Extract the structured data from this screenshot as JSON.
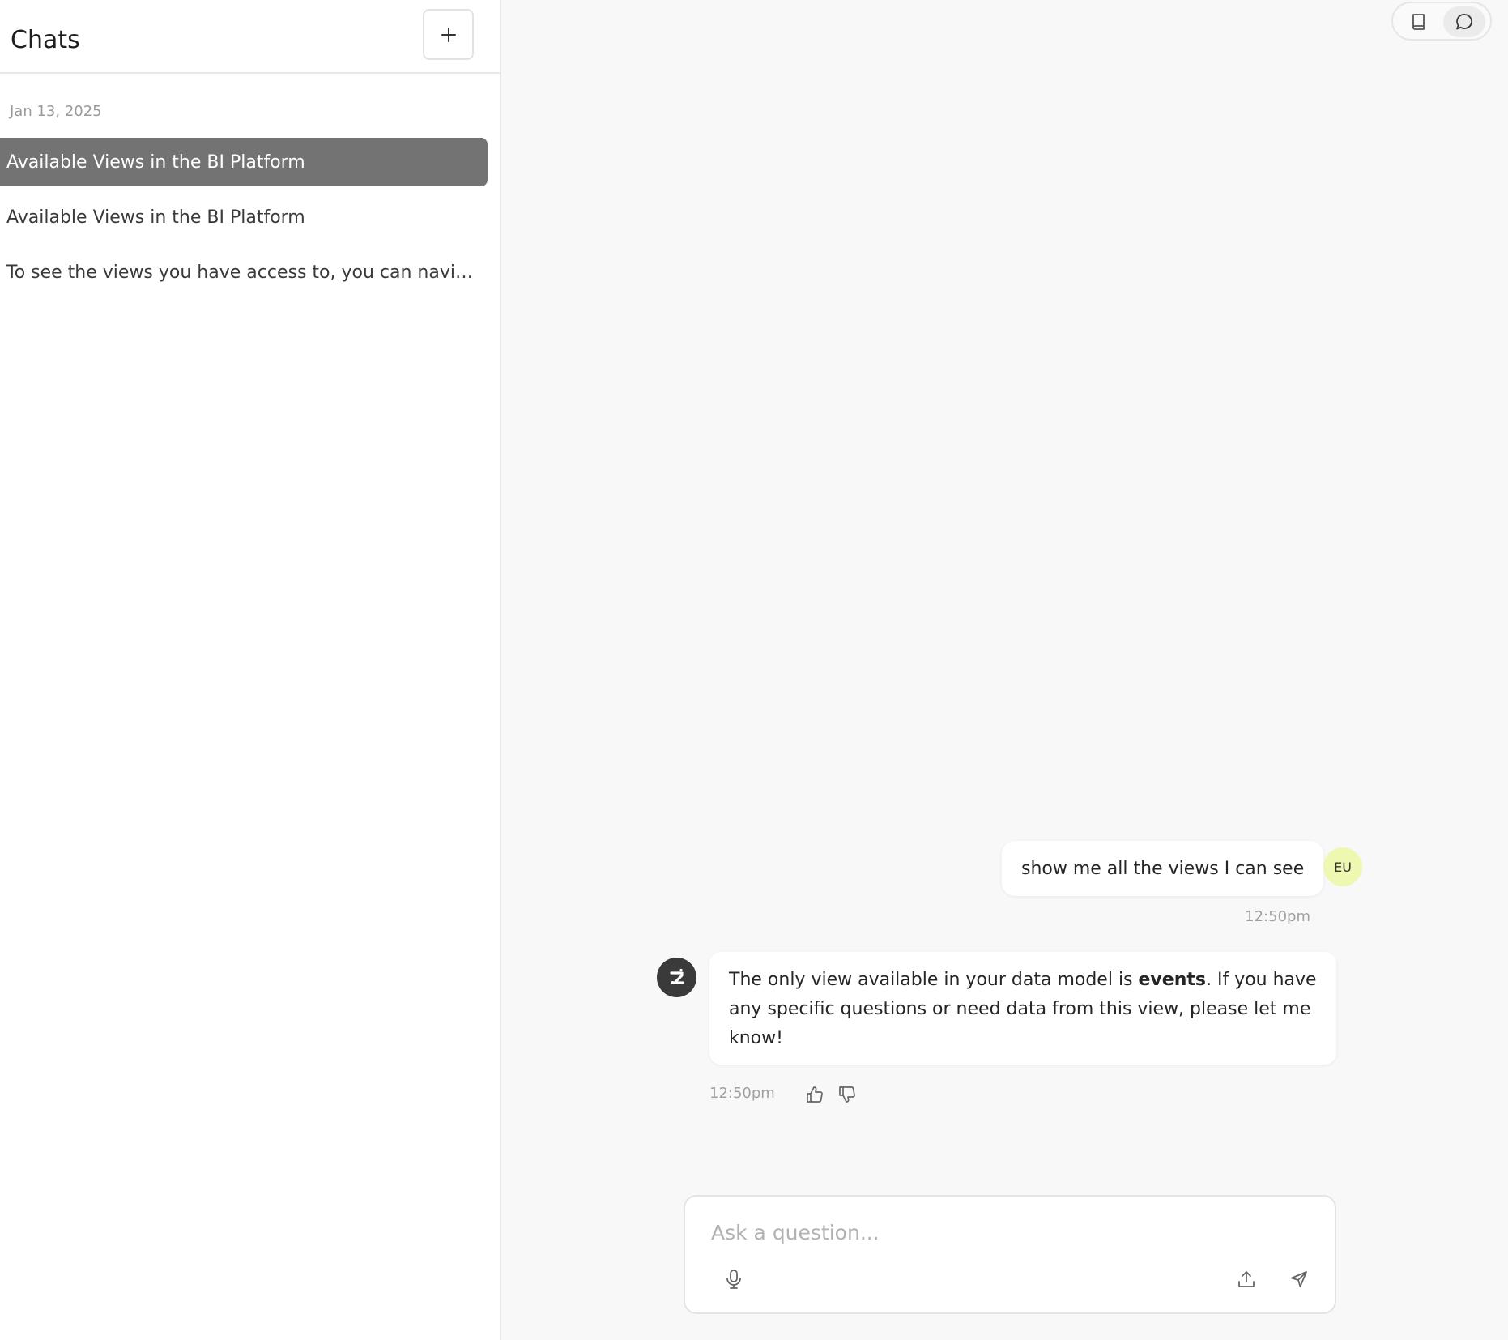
{
  "sidebar": {
    "title": "Chats",
    "new_chat_icon": "plus-icon",
    "date_group": "Jan 13, 2025",
    "items": [
      {
        "label": "Available Views in the BI Platform",
        "active": true
      },
      {
        "label": "Available Views in the BI Platform",
        "active": false
      },
      {
        "label": "To see the views you have access to, you can navigat...",
        "active": false
      }
    ]
  },
  "toolbar": {
    "docs_icon": "book-icon",
    "chat_icon": "chat-bubble-icon",
    "active_view": "chat"
  },
  "messages": {
    "user": {
      "text": "show me all the views I can see",
      "avatar_initials": "EU",
      "time": "12:50pm"
    },
    "assistant": {
      "text_before": "The only view available in your data model is ",
      "text_bold": "events",
      "text_after": ". If you have any specific questions or need data from this view, please let me know!",
      "time": "12:50pm",
      "avatar_icon": "bot-logo-icon"
    }
  },
  "composer": {
    "placeholder": "Ask a question...",
    "value": "",
    "mic_icon": "microphone-icon",
    "upload_icon": "upload-icon",
    "send_icon": "send-icon"
  },
  "colors": {
    "active_chat_bg": "#737373",
    "avatar_bg": "#eef8b0",
    "bot_avatar_bg": "#3a3a3a",
    "page_bg": "#f8f8f8"
  }
}
